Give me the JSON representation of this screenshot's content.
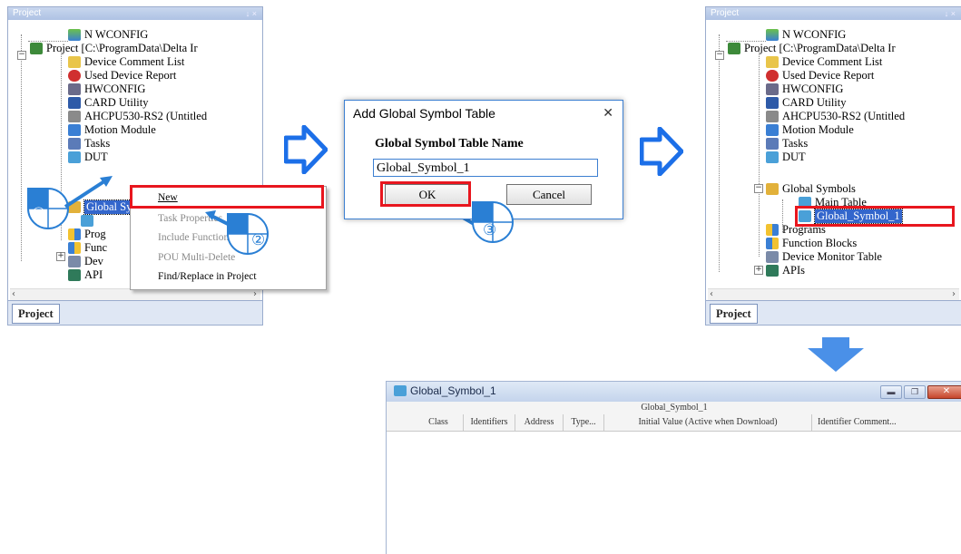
{
  "left_panel": {
    "title": "Project",
    "pin_controls": "↓ ×",
    "tree": [
      {
        "label": "N WCONFIG"
      },
      {
        "label": "Project [C:\\ProgramData\\Delta Ir"
      },
      {
        "label": "Device Comment List"
      },
      {
        "label": "Used Device Report"
      },
      {
        "label": "HWCONFIG"
      },
      {
        "label": "CARD Utility"
      },
      {
        "label": "AHCPU530-RS2  (Untitled"
      },
      {
        "label": "Motion Module"
      },
      {
        "label": "Tasks"
      },
      {
        "label": "DUT"
      },
      {
        "label": "Global Symbols"
      },
      {
        "label": "Prog"
      },
      {
        "label": "Func"
      },
      {
        "label": "Dev"
      },
      {
        "label": "API"
      }
    ],
    "tab_label": "Project"
  },
  "context_menu": {
    "items": [
      {
        "label": "New",
        "enabled": true
      },
      {
        "label": "Task Properties",
        "enabled": false
      },
      {
        "label": "Include Function Blocks",
        "enabled": false
      },
      {
        "label": "POU Multi-Delete",
        "enabled": false
      },
      {
        "label": "Find/Replace in Project",
        "enabled": true
      }
    ]
  },
  "dialog": {
    "title": "Add Global Symbol Table",
    "close_glyph": "✕",
    "field_label": "Global Symbol Table Name",
    "field_value": "Global_Symbol_1",
    "ok_label": "OK",
    "cancel_label": "Cancel"
  },
  "right_panel": {
    "title": "Project",
    "pin_controls": "↓ ×",
    "tree": [
      {
        "label": "N WCONFIG"
      },
      {
        "label": "Project [C:\\ProgramData\\Delta Ir"
      },
      {
        "label": "Device Comment List"
      },
      {
        "label": "Used Device Report"
      },
      {
        "label": "HWCONFIG"
      },
      {
        "label": "CARD Utility"
      },
      {
        "label": "AHCPU530-RS2  (Untitled"
      },
      {
        "label": "Motion Module"
      },
      {
        "label": "Tasks"
      },
      {
        "label": "DUT"
      },
      {
        "label": "Global Symbols"
      },
      {
        "label": "Main Table"
      },
      {
        "label": "Global_Symbol_1"
      },
      {
        "label": "Programs"
      },
      {
        "label": "Function Blocks"
      },
      {
        "label": "Device Monitor Table"
      },
      {
        "label": "APIs"
      }
    ],
    "tab_label": "Project"
  },
  "symbol_window": {
    "title": "Global_Symbol_1",
    "table_caption": "Global_Symbol_1",
    "columns": [
      "Class",
      "Identifiers",
      "Address",
      "Type...",
      "Initial Value (Active when Download)",
      "Identifier Comment..."
    ]
  },
  "steps": [
    "①",
    "②",
    "③"
  ],
  "colors": {
    "arrow_blue": "#1c6fe8",
    "highlight_red": "#e8161e",
    "selection_blue": "#3366cc",
    "step_circle_blue": "#2a7fd4"
  }
}
